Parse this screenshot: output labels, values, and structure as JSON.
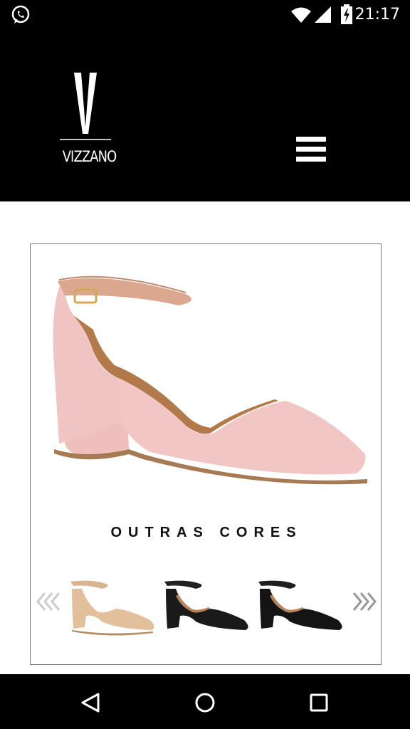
{
  "status_bar": {
    "time": "21:17",
    "icons": [
      "whatsapp-icon",
      "wifi-icon",
      "cell-signal-icon",
      "battery-charging-icon"
    ]
  },
  "header": {
    "brand": "VIZZANO",
    "menu_icon": "hamburger-menu-icon"
  },
  "product": {
    "colors": {
      "main_shoe": "#f1c3c2",
      "strap": "#dba48d",
      "sole": "#b07f55"
    }
  },
  "other_colors": {
    "title": "OUTRAS CORES",
    "prev_icon": "chevrons-left-icon",
    "next_icon": "chevrons-right-icon",
    "swatches": [
      {
        "color": "#e8c7a7",
        "name": "nude"
      },
      {
        "color": "#1a1a1a",
        "name": "black"
      },
      {
        "color": "#141414",
        "name": "black-suede"
      }
    ]
  },
  "nav_bar": {
    "buttons": [
      "back-triangle-icon",
      "home-circle-icon",
      "recents-square-icon"
    ]
  }
}
